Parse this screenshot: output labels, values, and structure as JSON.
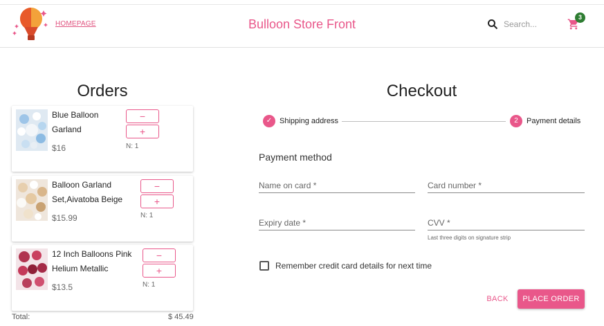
{
  "header": {
    "home_link": "HOMEPAGE",
    "store_title": "Bulloon Store Front",
    "search_placeholder": "Search...",
    "cart_count": "3",
    "logo_icon": "hot-air-balloon-logo",
    "search_icon": "search-icon",
    "cart_icon": "shopping-cart-icon"
  },
  "orders": {
    "title": "Orders",
    "items": [
      {
        "name_line1": "Blue Balloon",
        "name_line2": "Garland",
        "price": "$16",
        "qty": "N: 1",
        "minus": "−",
        "plus": "+"
      },
      {
        "name_line1": "Balloon Garland",
        "name_line2": "Set,Aivatoba Beige",
        "price": "$15.99",
        "qty": "N: 1",
        "minus": "−",
        "plus": "+"
      },
      {
        "name_line1": "12 Inch Balloons Pink",
        "name_line2": "Helium Metallic",
        "price": "$13.5",
        "qty": "N: 1",
        "minus": "−",
        "plus": "+"
      }
    ],
    "total_label": "Total:",
    "total_value": "$ 45.49"
  },
  "checkout": {
    "title": "Checkout",
    "steps": [
      {
        "label": "Shipping address",
        "marker": "✓",
        "completed": true
      },
      {
        "label": "Payment details",
        "marker": "2",
        "completed": false
      }
    ],
    "section_title": "Payment method",
    "fields": {
      "name_on_card": "Name on card *",
      "card_number": "Card number *",
      "expiry_date": "Expiry date *",
      "cvv": "CVV *",
      "cvv_helper": "Last three digits on signature strip"
    },
    "remember_label": "Remember credit card details for next time",
    "back_label": "BACK",
    "place_order_label": "PLACE ORDER"
  },
  "colors": {
    "accent": "#e9578a",
    "badge": "#2e7d32"
  }
}
